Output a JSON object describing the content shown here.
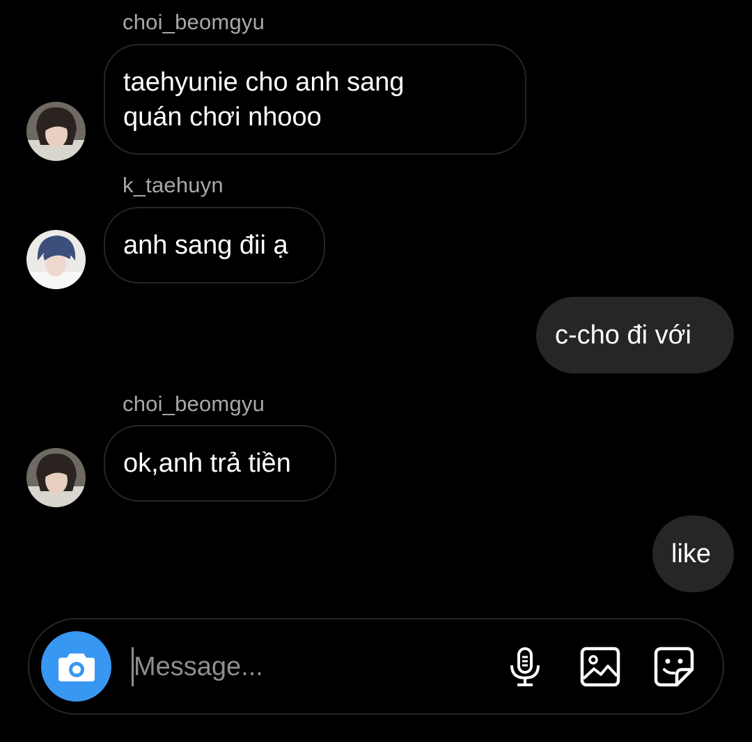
{
  "messages": [
    {
      "sender": "choi_beomgyu",
      "text_line1": "taehyunie cho anh sang",
      "text_line2": "quán chơi nhooo"
    },
    {
      "sender": "k_taehuyn",
      "text": "anh sang đii ạ"
    },
    {
      "text": "c-cho đi với"
    },
    {
      "sender": "choi_beomgyu",
      "text": "ok,anh trả tiền"
    },
    {
      "text": "like"
    }
  ],
  "composer": {
    "placeholder": "Message...",
    "value": "",
    "icons": [
      "camera-icon",
      "microphone-icon",
      "gallery-icon",
      "sticker-icon"
    ]
  },
  "colors": {
    "background": "#000000",
    "incoming_border": "#262626",
    "outgoing_fill": "#262626",
    "sender_text": "#a8a8a8",
    "camera_button": "#3897f0",
    "placeholder": "#8e8e8e"
  }
}
